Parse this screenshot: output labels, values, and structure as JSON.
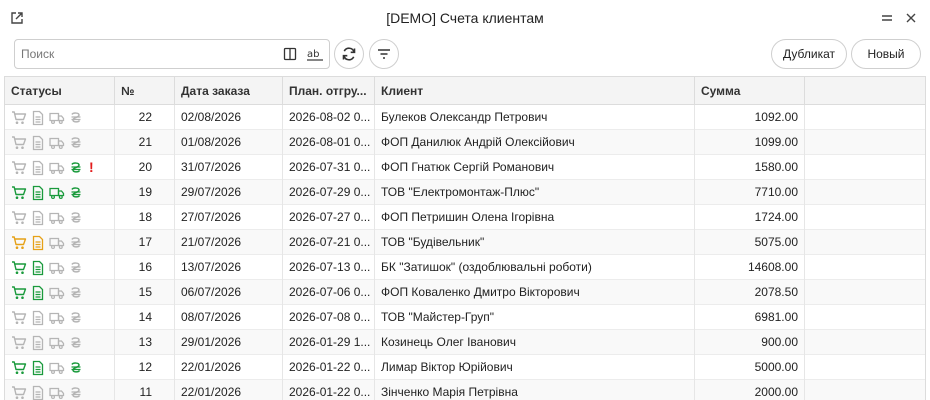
{
  "window": {
    "title": "[DEMO] Счета клиентам"
  },
  "toolbar": {
    "search_placeholder": "Поиск",
    "duplicate_label": "Дубликат",
    "new_label": "Новый"
  },
  "colors": {
    "green": "#1a9a3c",
    "orange": "#e6a117",
    "gray": "#b5b5b5",
    "alert": "#e21b1b"
  },
  "table": {
    "columns": [
      "Статусы",
      "№",
      "Дата заказа",
      "План. отгру...",
      "Клиент",
      "Сумма"
    ],
    "rows": [
      {
        "num": "22",
        "date": "02/08/2026",
        "plan": "2026-08-02 0...",
        "client": "Булеков Олександр Петрович",
        "sum": "1092.00",
        "status": {
          "cart": "gray",
          "doc": "gray",
          "truck": "gray",
          "money": "gray",
          "alert": ""
        }
      },
      {
        "num": "21",
        "date": "01/08/2026",
        "plan": "2026-08-01 0...",
        "client": "ФОП Данилюк Андрій Олексійович",
        "sum": "1099.00",
        "status": {
          "cart": "gray",
          "doc": "gray",
          "truck": "gray",
          "money": "gray",
          "alert": ""
        }
      },
      {
        "num": "20",
        "date": "31/07/2026",
        "plan": "2026-07-31 0...",
        "client": "ФОП Гнатюк Сергій Романович",
        "sum": "1580.00",
        "status": {
          "cart": "gray",
          "doc": "gray",
          "truck": "gray",
          "money": "green",
          "alert": "!"
        }
      },
      {
        "num": "19",
        "date": "29/07/2026",
        "plan": "2026-07-29 0...",
        "client": "ТОВ \"Електромонтаж-Плюс\"",
        "sum": "7710.00",
        "status": {
          "cart": "green",
          "doc": "green",
          "truck": "green",
          "money": "green",
          "alert": ""
        }
      },
      {
        "num": "18",
        "date": "27/07/2026",
        "plan": "2026-07-27 0...",
        "client": "ФОП Петришин Олена Ігорівна",
        "sum": "1724.00",
        "status": {
          "cart": "gray",
          "doc": "gray",
          "truck": "gray",
          "money": "gray",
          "alert": ""
        }
      },
      {
        "num": "17",
        "date": "21/07/2026",
        "plan": "2026-07-21 0...",
        "client": "ТОВ \"Будівельник\"",
        "sum": "5075.00",
        "status": {
          "cart": "orange",
          "doc": "orange",
          "truck": "gray",
          "money": "gray",
          "alert": ""
        }
      },
      {
        "num": "16",
        "date": "13/07/2026",
        "plan": "2026-07-13 0...",
        "client": "БК \"Затишок\" (оздоблювальні роботи)",
        "sum": "14608.00",
        "status": {
          "cart": "green",
          "doc": "green",
          "truck": "gray",
          "money": "gray",
          "alert": ""
        }
      },
      {
        "num": "15",
        "date": "06/07/2026",
        "plan": "2026-07-06 0...",
        "client": "ФОП Коваленко Дмитро Вікторович",
        "sum": "2078.50",
        "status": {
          "cart": "green",
          "doc": "green",
          "truck": "gray",
          "money": "gray",
          "alert": ""
        }
      },
      {
        "num": "14",
        "date": "08/07/2026",
        "plan": "2026-07-08 0...",
        "client": "ТОВ \"Майстер-Груп\"",
        "sum": "6981.00",
        "status": {
          "cart": "gray",
          "doc": "gray",
          "truck": "gray",
          "money": "gray",
          "alert": ""
        }
      },
      {
        "num": "13",
        "date": "29/01/2026",
        "plan": "2026-01-29 1...",
        "client": "Козинець Олег Іванович",
        "sum": "900.00",
        "status": {
          "cart": "gray",
          "doc": "gray",
          "truck": "gray",
          "money": "gray",
          "alert": ""
        }
      },
      {
        "num": "12",
        "date": "22/01/2026",
        "plan": "2026-01-22 0...",
        "client": "Лимар Віктор Юрійович",
        "sum": "5000.00",
        "status": {
          "cart": "green",
          "doc": "green",
          "truck": "gray",
          "money": "green",
          "alert": ""
        }
      },
      {
        "num": "11",
        "date": "22/01/2026",
        "plan": "2026-01-22 0...",
        "client": "Зінченко Марія Петрівна",
        "sum": "2000.00",
        "status": {
          "cart": "gray",
          "doc": "gray",
          "truck": "gray",
          "money": "gray",
          "alert": ""
        }
      }
    ]
  }
}
